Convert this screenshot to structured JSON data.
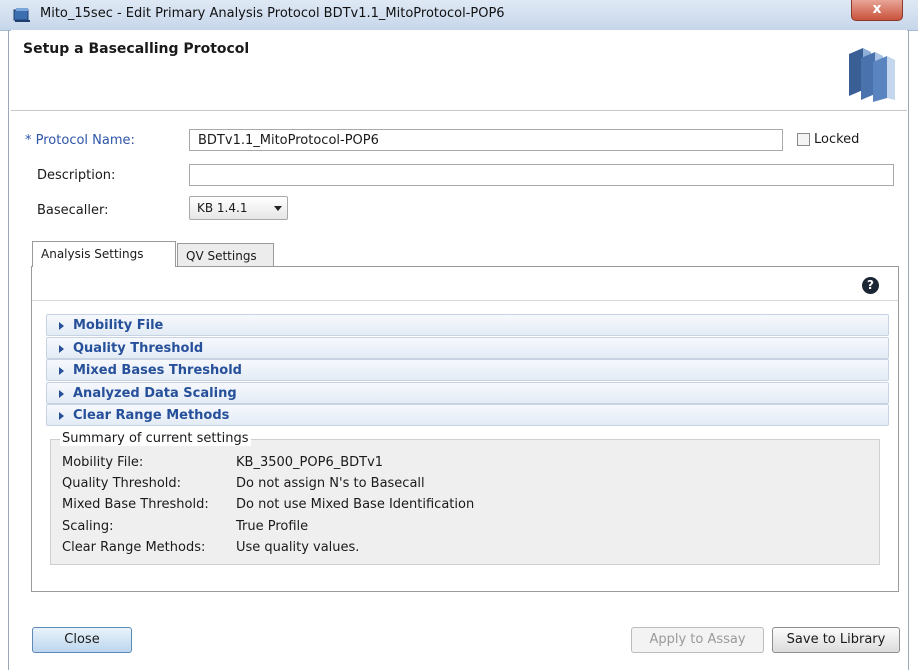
{
  "window": {
    "title": "Mito_15sec - Edit Primary Analysis Protocol BDTv1.1_MitoProtocol-POP6",
    "close_glyph": "x"
  },
  "header": {
    "title": "Setup a Basecalling Protocol"
  },
  "form": {
    "protocol_name_marker": "*",
    "protocol_name_label": "Protocol Name:",
    "protocol_name_value": "BDTv1.1_MitoProtocol-POP6",
    "locked_label": "Locked",
    "description_label": "Description:",
    "description_value": "",
    "basecaller_label": "Basecaller:",
    "basecaller_value": "KB 1.4.1"
  },
  "tabs": [
    {
      "label": "Analysis Settings",
      "active": true
    },
    {
      "label": "QV Settings",
      "active": false
    }
  ],
  "help_glyph": "?",
  "sections": [
    {
      "label": "Mobility File"
    },
    {
      "label": "Quality Threshold"
    },
    {
      "label": "Mixed Bases Threshold"
    },
    {
      "label": "Analyzed Data Scaling"
    },
    {
      "label": "Clear Range Methods"
    }
  ],
  "summary": {
    "title": "Summary of current settings",
    "rows": [
      {
        "key": "Mobility File:",
        "value": "KB_3500_POP6_BDTv1"
      },
      {
        "key": "Quality Threshold:",
        "value": "Do not assign N's to Basecall"
      },
      {
        "key": "Mixed Base Threshold:",
        "value": "Do not use Mixed Base Identification"
      },
      {
        "key": "Scaling:",
        "value": "True Profile"
      },
      {
        "key": "Clear Range Methods:",
        "value": "Use quality values."
      }
    ]
  },
  "buttons": {
    "close": "Close",
    "apply": "Apply to Assay",
    "save": "Save to Library"
  },
  "colors": {
    "accent": "#26509a",
    "required": "#2e55a8",
    "close_button": "#c9523c"
  }
}
